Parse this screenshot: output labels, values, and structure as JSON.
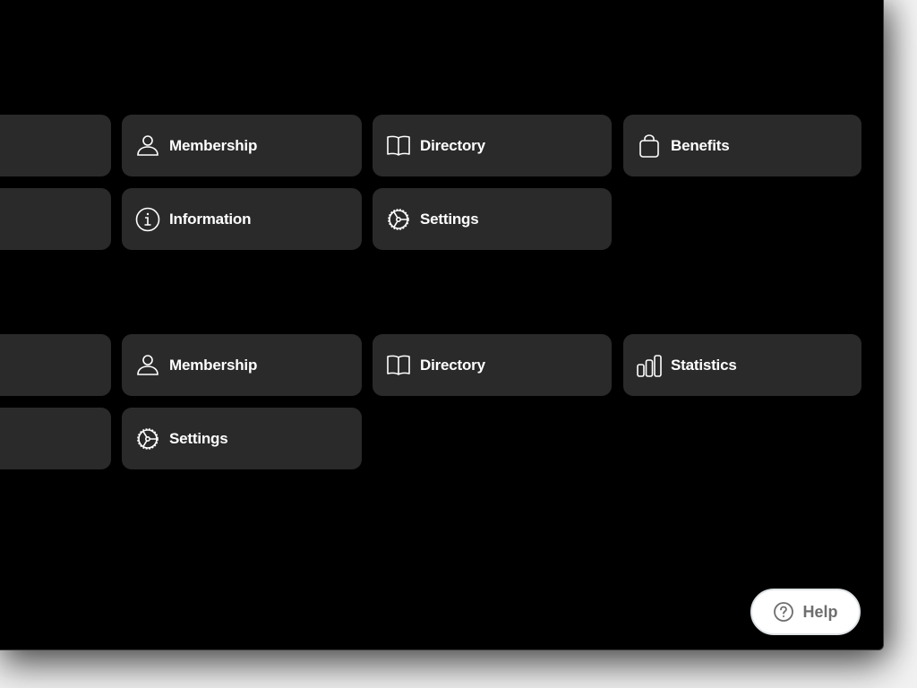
{
  "sections": [
    {
      "rows": [
        [
          {
            "label": "",
            "icon": "none"
          },
          {
            "label": "Membership",
            "icon": "person-icon"
          },
          {
            "label": "Directory",
            "icon": "book-icon"
          },
          {
            "label": "Benefits",
            "icon": "bag-icon"
          }
        ],
        [
          {
            "label": "",
            "icon": "none"
          },
          {
            "label": "Information",
            "icon": "info-icon"
          },
          {
            "label": "Settings",
            "icon": "gear-icon"
          }
        ]
      ]
    },
    {
      "rows": [
        [
          {
            "label": "",
            "icon": "none"
          },
          {
            "label": "Membership",
            "icon": "person-icon"
          },
          {
            "label": "Directory",
            "icon": "book-icon"
          },
          {
            "label": "Statistics",
            "icon": "chart-bars-icon"
          }
        ],
        [
          {
            "label": "",
            "icon": "none"
          },
          {
            "label": "Settings",
            "icon": "gear-icon"
          }
        ]
      ]
    }
  ],
  "help": {
    "label": "Help",
    "icon": "question-circle-icon"
  },
  "colors": {
    "window_bg": "#000000",
    "tile_bg": "#2a2a2a",
    "tile_text": "#ffffff",
    "help_text": "#6e6e6e"
  }
}
